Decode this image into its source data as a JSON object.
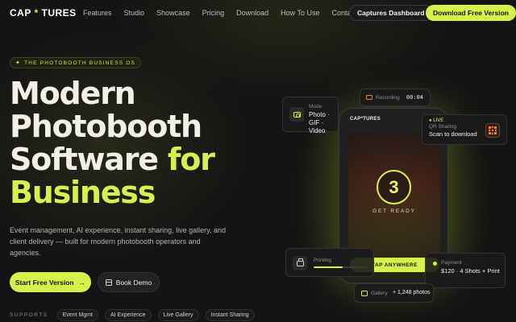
{
  "nav": {
    "logo_left": "CAP",
    "logo_star": "*",
    "logo_right": "TURES",
    "links": [
      "Features",
      "Studio",
      "Showcase",
      "Pricing",
      "Download",
      "How To Use",
      "Contact"
    ],
    "dashboard_button": "Captures Dashboard",
    "download_button": "Download Free Version"
  },
  "hero": {
    "eyebrow": "THE PHOTOBOOTH BUSINESS OS",
    "headline": {
      "line1": "Modern",
      "line2": "Photobooth",
      "line3a": "Software",
      "line3b": "for",
      "line4": "Business"
    },
    "subtitle": "Event management, AI experience, instant sharing, live gallery, and client delivery — built for modern photobooth operators and agencies.",
    "start_button": "Start Free Version",
    "demo_button": "Book Demo",
    "supports_label": "SUPPORTS",
    "supports": [
      "Event Mgmt",
      "AI Experience",
      "Live Gallery",
      "Instant Sharing"
    ]
  },
  "phone": {
    "logo": "CAP*TURES",
    "countdown": "3",
    "get_ready": "GET READY",
    "tap_button": "TAP ANYWHERE"
  },
  "cards": {
    "mode": {
      "label": "Mode",
      "value": "Photo · GIF · Video"
    },
    "recording": {
      "label": "Recording",
      "time": "00:04"
    },
    "qr": {
      "badge": "● LIVE",
      "label": "QR Sharing",
      "value": "Scan to download"
    },
    "printing": {
      "label": "Printing",
      "progress": 0.55
    },
    "payment": {
      "label": "Payment",
      "value": "$120 · 4 Shots + Print"
    },
    "gallery": {
      "label": "Gallery",
      "value": "+ 1,248 photos"
    }
  },
  "colors": {
    "accent": "#d6f24a",
    "background": "#141414",
    "recording": "#ff7a3a"
  },
  "icons": [
    "sparkle-icon",
    "arrow-right-icon",
    "calendar-icon",
    "camera-icon",
    "record-icon",
    "qr-code-icon",
    "printer-icon",
    "gallery-icon"
  ]
}
